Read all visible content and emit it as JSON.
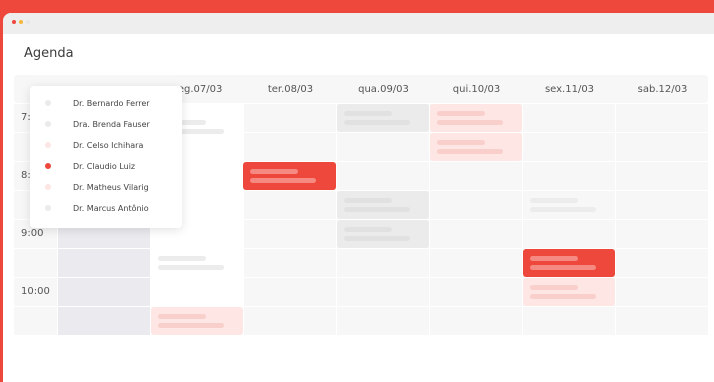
{
  "page_title": "Agenda",
  "columns": [
    "seg.07/03",
    "ter.08/03",
    "qua.09/03",
    "qui.10/03",
    "sex.11/03",
    "sab.12/03"
  ],
  "hours": [
    "7:00",
    "8:00",
    "9:00",
    "10:00"
  ],
  "doctors": [
    {
      "name": "Dr. Bernardo Ferrer",
      "selected": false
    },
    {
      "name": "Dra. Brenda Fauser",
      "selected": false
    },
    {
      "name": "Dr. Celso Ichihara",
      "selected": false
    },
    {
      "name": "Dr. Claudio Luiz",
      "selected": true
    },
    {
      "name": "Dr. Matheus Vilarig",
      "selected": false
    },
    {
      "name": "Dr. Marcus Antônio",
      "selected": false
    }
  ],
  "colors": {
    "accent": "#ee473b",
    "faded_accent": "#fde6e4",
    "grey_block": "#ebebeb",
    "cell": "#f7f7f7"
  }
}
